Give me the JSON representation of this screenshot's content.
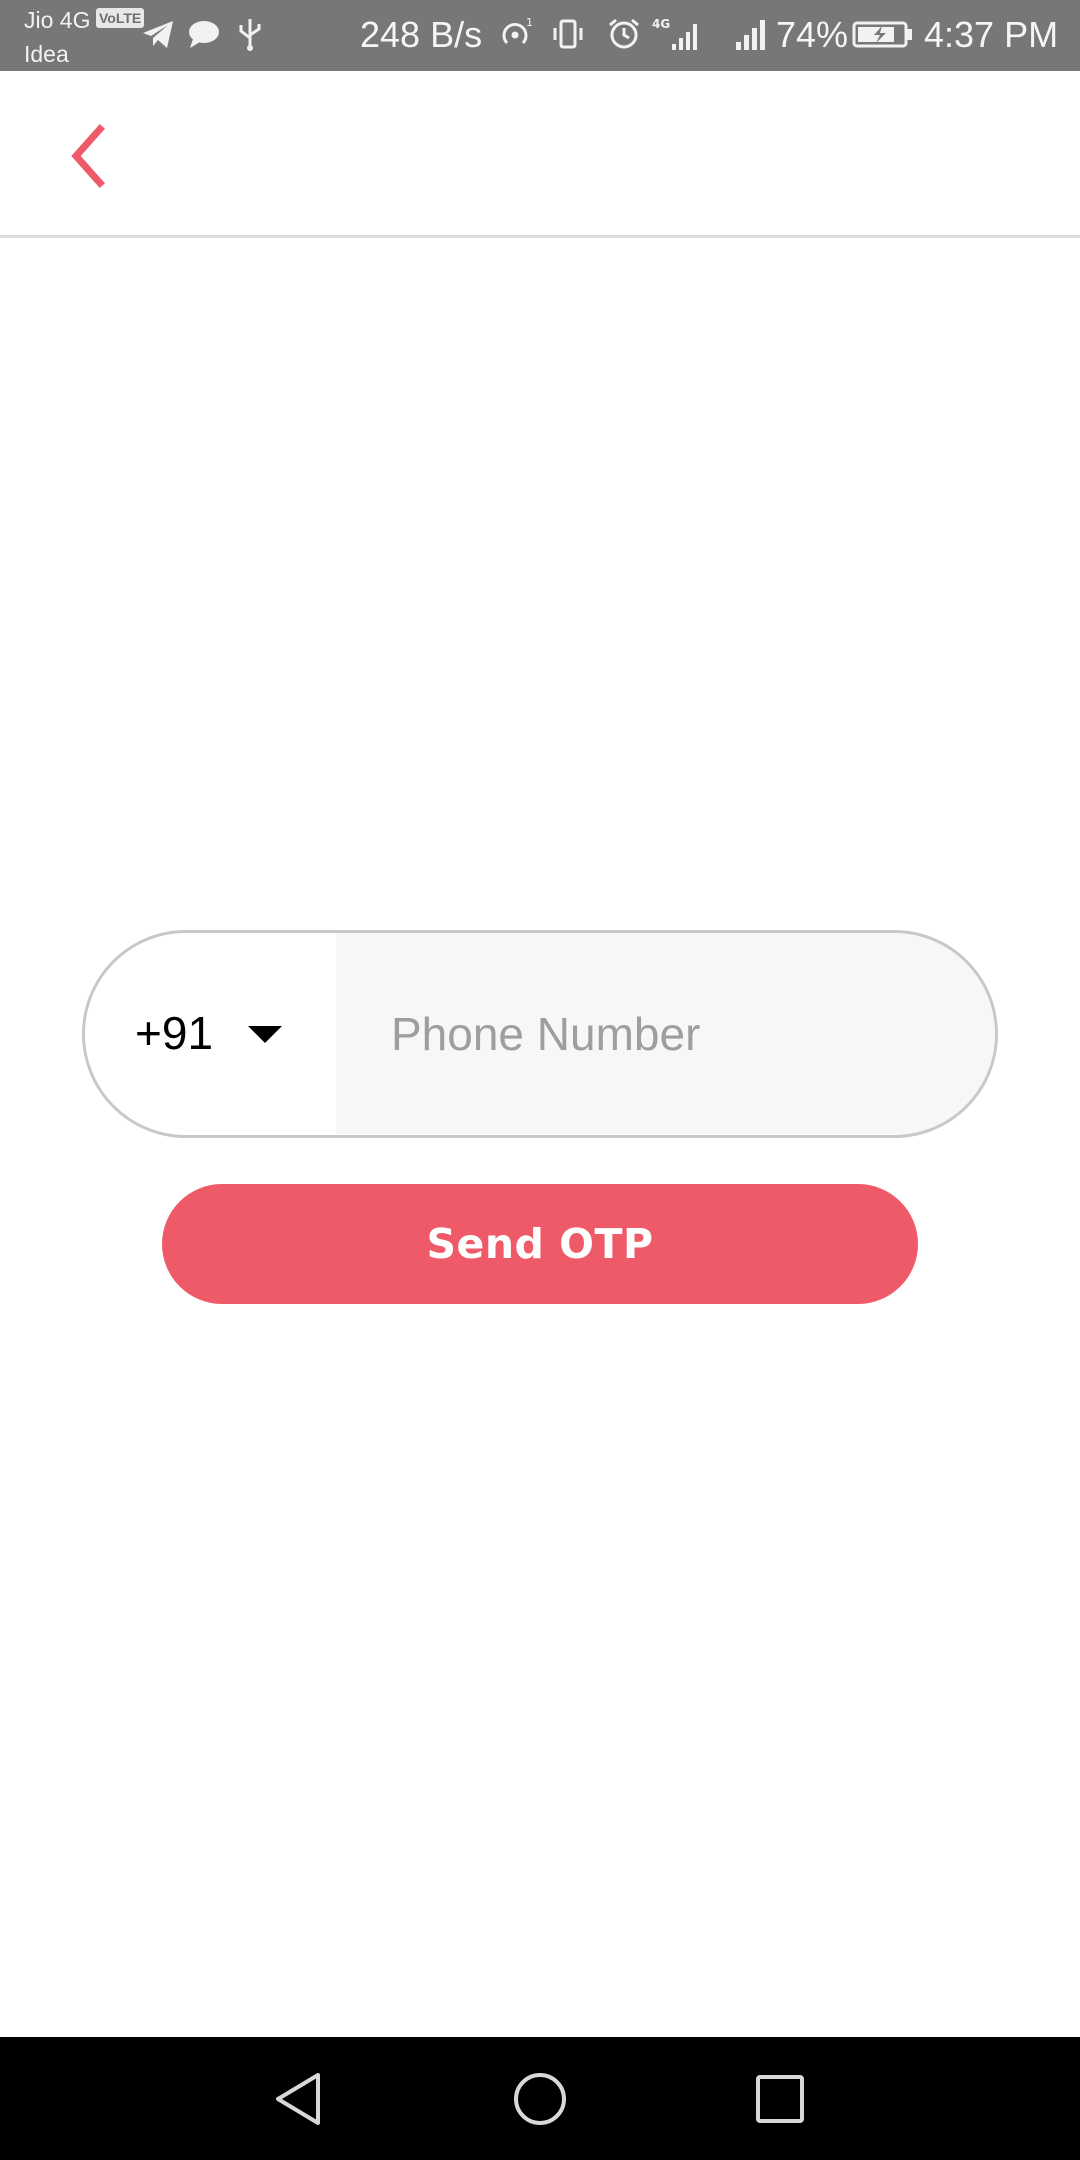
{
  "status_bar": {
    "carrier_primary": "Jio 4G",
    "volte_label": "VoLTE",
    "carrier_secondary": "Idea",
    "network_speed": "248 B/s",
    "battery_percent": "74%",
    "time": "4:37 PM",
    "icons": [
      "telegram-icon",
      "message-icon",
      "usb-icon",
      "hotspot-icon",
      "vibrate-icon",
      "alarm-icon",
      "signal-4g-icon",
      "signal-icon",
      "battery-charging-icon"
    ]
  },
  "app_bar": {
    "back_icon": "chevron-left-icon"
  },
  "phone_field": {
    "country_code": "+91",
    "dropdown_icon": "caret-down-icon",
    "placeholder": "Phone Number",
    "value": ""
  },
  "send_otp": {
    "label": "Send OTP"
  },
  "nav_bar": {
    "icons": [
      "back-triangle-icon",
      "home-circle-icon",
      "recents-square-icon"
    ]
  },
  "colors": {
    "accent": "#ef5a68",
    "status_bar": "#777777",
    "input_bg": "#f6f7f7",
    "border": "#c8c8c8"
  }
}
